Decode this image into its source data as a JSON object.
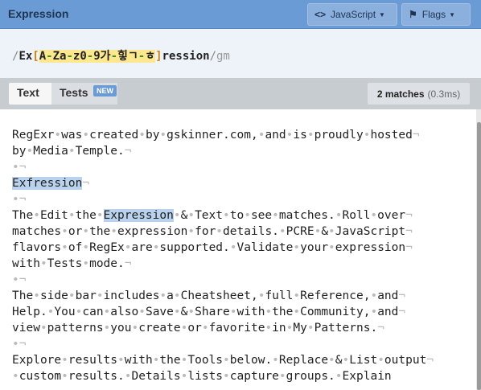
{
  "header": {
    "title": "Expression",
    "lang_label": "JavaScript",
    "flags_label": "Flags",
    "lang_icon": "code-brackets-icon",
    "flags_icon": "flag-icon"
  },
  "expression": {
    "open_slash": "/",
    "prefix": "Ex",
    "open_bracket": "[",
    "set_parts": [
      "A",
      "-",
      "Z",
      "a",
      "-",
      "z",
      "0",
      "-",
      "9",
      "가",
      "-",
      "힣",
      "ㄱ",
      "-",
      "ㅎ"
    ],
    "close_bracket": "]",
    "suffix": "ression",
    "close_slash": "/",
    "flags": "gm"
  },
  "tabs": {
    "text": "Text",
    "tests": "Tests",
    "new_badge": "NEW"
  },
  "status": {
    "matches": "2 matches",
    "time": "(0.3ms)"
  },
  "text_lines": [
    "RegExr was created by gskinner.com, and is proudly hosted",
    "by Media Temple.",
    "",
    "Exfression",
    "",
    "The Edit the Expression & Text to see matches. Roll over",
    "matches or the expression for details. PCRE & JavaScript",
    "flavors of RegEx are supported. Validate your expression",
    "with Tests mode.",
    "",
    "The side bar includes a Cheatsheet, full Reference, and",
    "Help. You can also Save & Share with the Community, and",
    "view patterns you create or favorite in My Patterns.",
    "",
    "Explore results with the Tools below. Replace & List output",
    " custom results. Details lists capture groups. Explain"
  ],
  "matched_words": [
    "Exfression",
    "Expression"
  ],
  "colors": {
    "header_bg": "#6b9bd5",
    "highlight": "#b9d3ee",
    "char_set_bg": "#fde88f"
  }
}
